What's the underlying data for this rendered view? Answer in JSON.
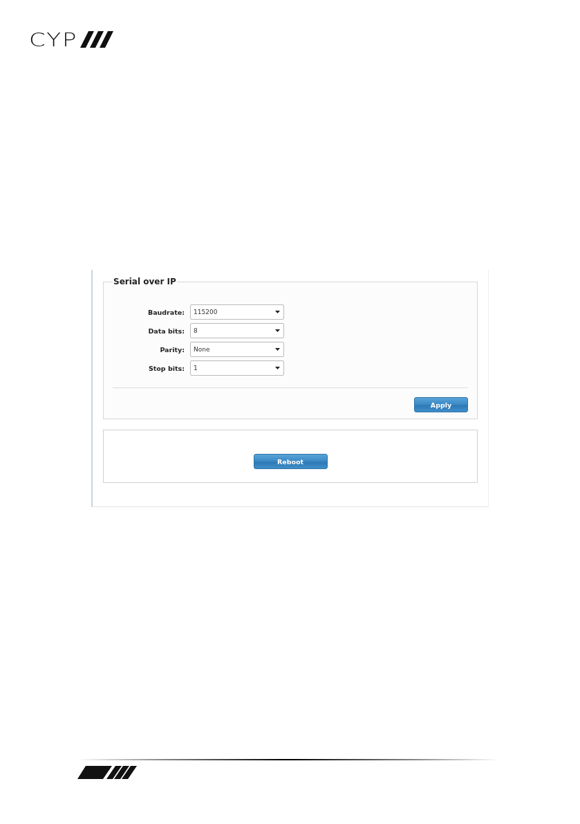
{
  "header": {
    "logo": "CYP"
  },
  "panel": {
    "title": "Serial over IP",
    "fields": [
      {
        "label": "Baudrate:",
        "value": "115200"
      },
      {
        "label": "Data bits:",
        "value": "8"
      },
      {
        "label": "Parity:",
        "value": "None"
      },
      {
        "label": "Stop bits:",
        "value": "1"
      }
    ],
    "apply_button": "Apply"
  },
  "reboot_button": "Reboot"
}
